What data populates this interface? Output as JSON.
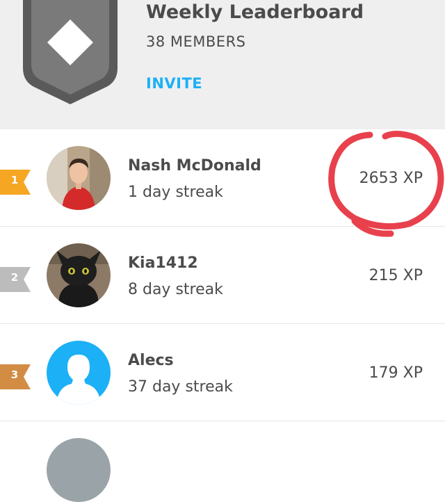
{
  "leaderboard": {
    "title": "Weekly Leaderboard",
    "members": "38 MEMBERS",
    "invite_label": "INVITE"
  },
  "colors": {
    "accent": "#1cb0f6",
    "text": "#4b4b4b",
    "header_bg": "#efefef",
    "shield": "#5a5a5a",
    "gold_rank": "#f5a623",
    "silver_rank": "#bcbcbc",
    "bronze_rank": "#d38c43",
    "annotation": "#e8414d"
  },
  "entries": [
    {
      "rank": "1",
      "name": "Nash McDonald",
      "streak": "1 day streak",
      "xp": "2653 XP",
      "avatar": "photo-avatar-person-red-vest",
      "badge": "gold-rank-ribbon"
    },
    {
      "rank": "2",
      "name": "Kia1412",
      "streak": "8 day streak",
      "xp": "215 XP",
      "avatar": "photo-avatar-black-dragon-plush",
      "badge": "silver-rank-ribbon"
    },
    {
      "rank": "3",
      "name": "Alecs",
      "streak": "37 day streak",
      "xp": "179 XP",
      "avatar": "default-user-silhouette",
      "badge": "bronze-rank-ribbon"
    }
  ],
  "icons": {
    "shield": "diamond-shield-icon",
    "annotation": "red-hand-drawn-circle"
  }
}
